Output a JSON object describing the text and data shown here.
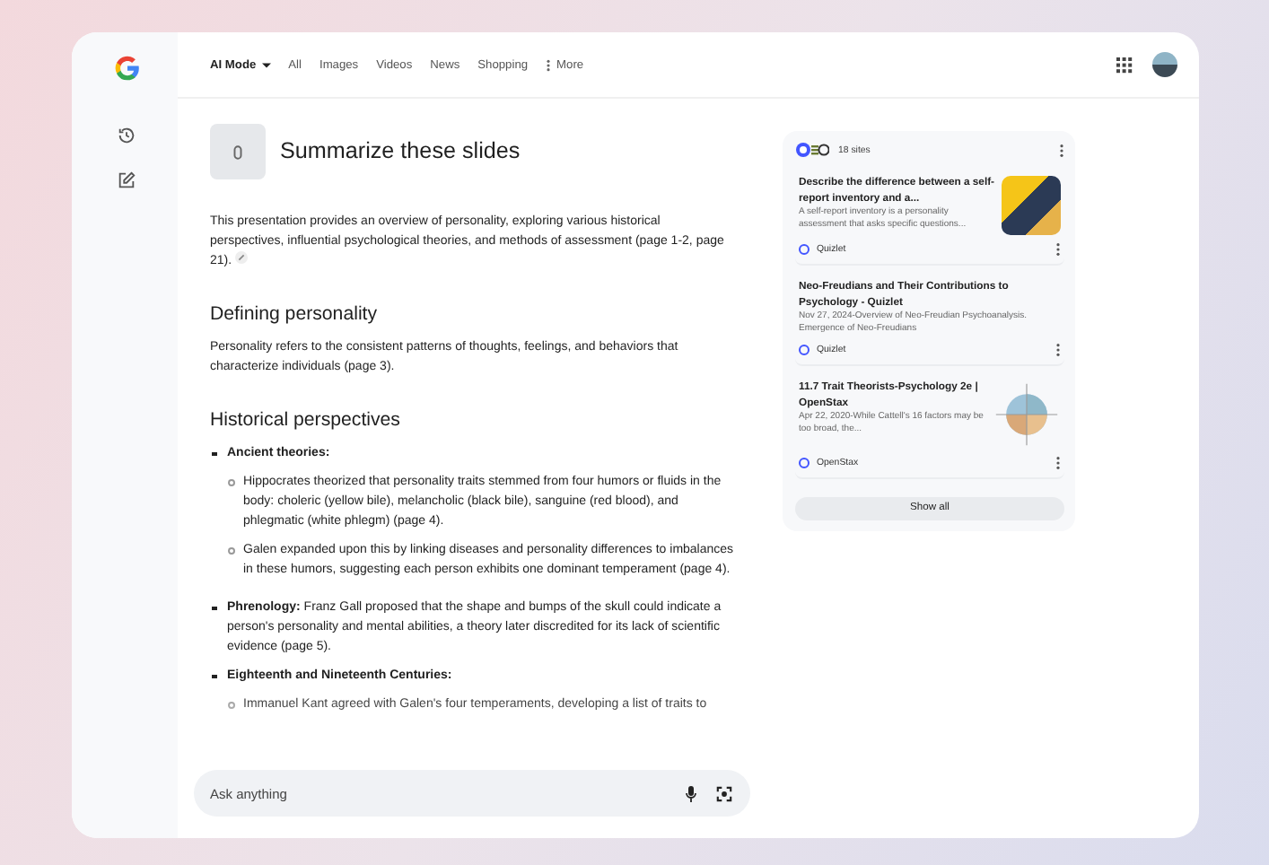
{
  "nav": {
    "tabs": [
      {
        "label": "AI Mode",
        "selected": true
      },
      {
        "label": "All",
        "selected": false
      },
      {
        "label": "Images",
        "selected": false
      },
      {
        "label": "Videos",
        "selected": false
      },
      {
        "label": "News",
        "selected": false
      },
      {
        "label": "Shopping",
        "selected": false
      },
      {
        "label": "More",
        "selected": false
      }
    ]
  },
  "query": {
    "title": "Summarize these slides"
  },
  "answer": {
    "intro": "This presentation provides an overview of personality, exploring various historical perspectives, influential psychological theories, and methods of assessment (page 1-2, page 21).",
    "sections": [
      {
        "heading": "Defining personality",
        "body": "Personality refers to the consistent patterns of thoughts, feelings, and behaviors that characterize individuals (page 3)."
      },
      {
        "heading": "Historical perspectives",
        "bullets": [
          {
            "kind": "label",
            "text": "Ancient theories:",
            "children": [
              {
                "text": "Hippocrates theorized that personality traits stemmed from four humors or fluids in the body: choleric (yellow bile), melancholic (black bile), sanguine (red blood), and phlegmatic (white phlegm) (page 4)."
              },
              {
                "text": "Galen expanded upon this by linking diseases and personality differences to imbalances in these humors, suggesting each person exhibits one dominant temperament (page 4)."
              }
            ]
          },
          {
            "kind": "text",
            "text": "**Phrenology:** Franz Gall proposed that the shape and bumps of the skull could indicate a person's personality and mental abilities, a theory later discredited for its lack of scientific evidence (page 5)."
          },
          {
            "kind": "label",
            "text": "Eighteenth and Nineteenth Centuries:",
            "children": [
              {
                "text": "Immanuel Kant agreed with Galen's four temperaments, developing a list of traits to"
              }
            ]
          }
        ]
      }
    ]
  },
  "input": {
    "placeholder": "Ask anything"
  },
  "sources": {
    "count": "18 sites",
    "items": [
      {
        "title": "Describe the difference between a self-report inventory and a...",
        "snippet": "A self-report inventory is a personality assessment that asks specific questions...",
        "site": "Quizlet",
        "kind": "photo"
      },
      {
        "title": "Neo-Freudians and Their Contributions to Psychology - Quizlet",
        "snippet": "Nov 27, 2024-Overview of Neo-Freudian Psychoanalysis. Emergence of Neo-Freudians",
        "site": "Quizlet",
        "kind": "plain"
      },
      {
        "title": "11.7 Trait Theorists-Psychology 2e | OpenStax",
        "snippet": "Apr 22, 2020-While Cattell's 16 factors may be too broad, the...",
        "site": "OpenStax",
        "kind": "diagram"
      }
    ],
    "show_all": "Show all"
  }
}
